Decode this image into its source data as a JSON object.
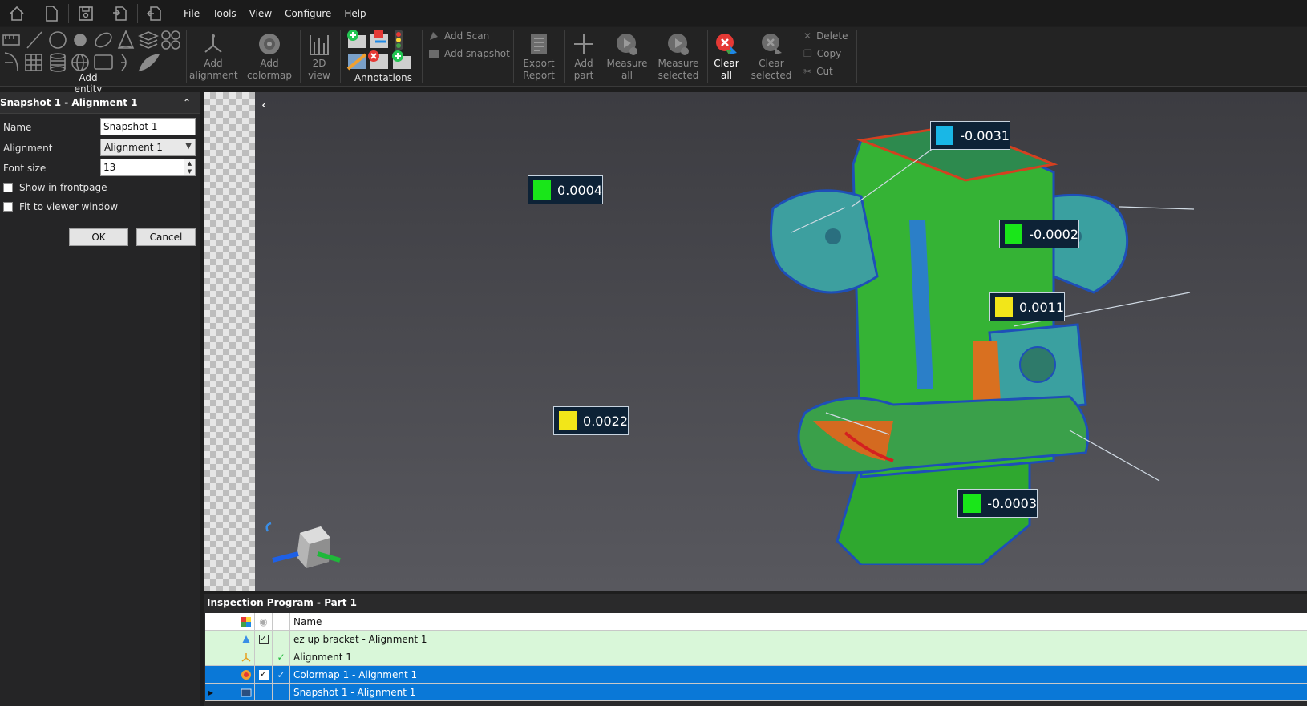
{
  "menu": {
    "items": [
      "File",
      "Tools",
      "View",
      "Configure",
      "Help"
    ]
  },
  "quick_access": [
    "home-icon",
    "new-file-icon",
    "save-icon",
    "import-icon",
    "export-icon"
  ],
  "ribbon": {
    "entity_group_label": "Add entity",
    "add_alignment": [
      "Add",
      "alignment"
    ],
    "add_colormap": [
      "Add",
      "colormap"
    ],
    "view_2d": [
      "2D",
      "view"
    ],
    "annotations_label": "Annotations",
    "add_scan": "Add Scan",
    "add_snapshot": "Add snapshot",
    "export_report": [
      "Export",
      "Report"
    ],
    "add_part": [
      "Add",
      "part"
    ],
    "measure_all": [
      "Measure",
      "all"
    ],
    "measure_selected": [
      "Measure",
      "selected"
    ],
    "clear_all": [
      "Clear",
      "all"
    ],
    "clear_selected": [
      "Clear",
      "selected"
    ],
    "delete": "Delete",
    "copy": "Copy",
    "cut": "Cut"
  },
  "panel": {
    "title": "Snapshot 1 - Alignment 1",
    "name_label": "Name",
    "name_value": "Snapshot 1",
    "alignment_label": "Alignment",
    "alignment_value": "Alignment 1",
    "font_size_label": "Font size",
    "font_size_value": "13",
    "show_frontpage": "Show in frontpage",
    "fit_viewer": "Fit to viewer window",
    "ok": "OK",
    "cancel": "Cancel"
  },
  "annotations": [
    {
      "value": "-0.0031",
      "color": "#19b7e6"
    },
    {
      "value": "0.0004",
      "color": "#19e619"
    },
    {
      "value": "-0.0002",
      "color": "#19e619"
    },
    {
      "value": "0.0011",
      "color": "#f2e619"
    },
    {
      "value": "0.0022",
      "color": "#f2e619"
    },
    {
      "value": "-0.0003",
      "color": "#19e619"
    }
  ],
  "inspection": {
    "title": "Inspection Program - Part 1",
    "name_header": "Name",
    "rows": [
      {
        "name": "ez up bracket - Alignment 1",
        "style": "light-green",
        "checked": true
      },
      {
        "name": "Alignment 1",
        "style": "light-green",
        "checked": false
      },
      {
        "name": "Colormap 1 - Alignment 1",
        "style": "selected",
        "checked": true
      },
      {
        "name": "Snapshot 1 - Alignment 1",
        "style": "selected",
        "checked": false
      }
    ]
  },
  "colors": {
    "selected_row": "#0a78d7",
    "light_green_row": "#d9f7d9",
    "clear_all_icon": "#e53935"
  }
}
